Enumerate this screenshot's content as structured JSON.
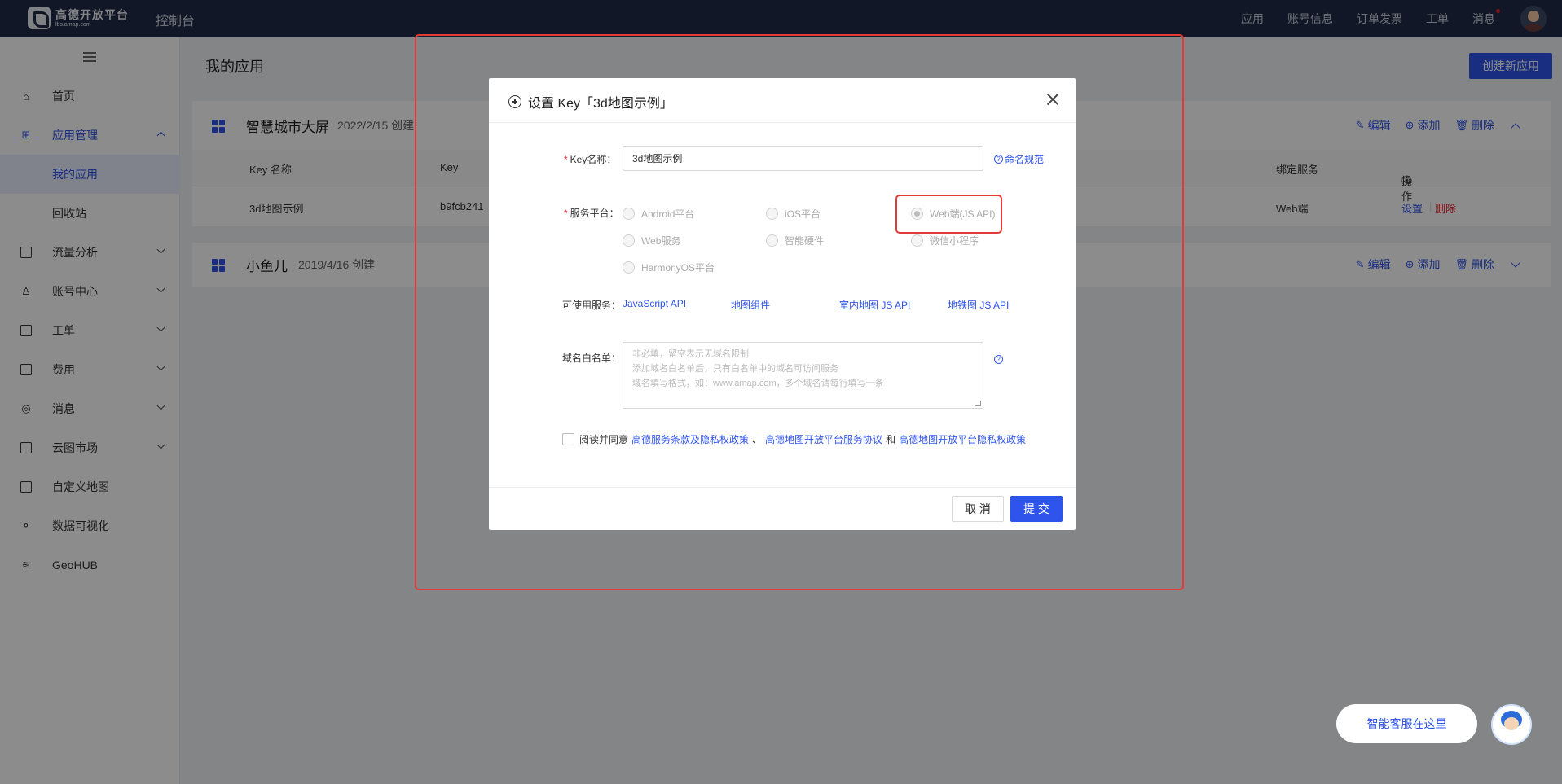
{
  "topbar": {
    "logo_name": "高德开放平台",
    "logo_sub": "lbs.amap.com",
    "title": "控制台",
    "nav": [
      "应用",
      "账号信息",
      "订单发票",
      "工单",
      "消息"
    ]
  },
  "sidebar": {
    "items": [
      {
        "label": "首页",
        "icon": "home-icon"
      },
      {
        "label": "应用管理",
        "icon": "app-grid-icon"
      },
      {
        "label": "我的应用"
      },
      {
        "label": "回收站"
      },
      {
        "label": "流量分析",
        "icon": "chart-icon"
      },
      {
        "label": "账号中心",
        "icon": "user-icon"
      },
      {
        "label": "工单",
        "icon": "ticket-icon"
      },
      {
        "label": "费用",
        "icon": "fee-icon"
      },
      {
        "label": "消息",
        "icon": "message-icon"
      },
      {
        "label": "云图市场",
        "icon": "store-icon"
      },
      {
        "label": "自定义地图",
        "icon": "map-edit-icon"
      },
      {
        "label": "数据可视化",
        "icon": "dataviz-icon"
      },
      {
        "label": "GeoHUB",
        "icon": "layers-icon"
      }
    ]
  },
  "main": {
    "title": "我的应用",
    "create_button": "创建新应用",
    "apps": [
      {
        "name": "智慧城市大屏",
        "date": "2022/2/15 创建",
        "actions": {
          "edit": "编辑",
          "add": "添加",
          "delete": "删除"
        },
        "columns": {
          "key_name": "Key 名称",
          "key": "Key",
          "bound_service": "绑定服务",
          "operation": "操作"
        },
        "rows": [
          {
            "key_name": "3d地图示例",
            "key": "b9fcb241",
            "service": "Web端",
            "op_settings": "设置",
            "op_delete": "删除"
          }
        ]
      },
      {
        "name": "小鱼儿",
        "date": "2019/4/16 创建",
        "actions": {
          "edit": "编辑",
          "add": "添加",
          "delete": "删除"
        }
      }
    ]
  },
  "modal": {
    "title": "设置 Key「3d地图示例」",
    "key_name_label": "Key名称：",
    "key_name_value": "3d地图示例",
    "naming_rule_link": "命名规范",
    "platform_label": "服务平台：",
    "platforms": [
      {
        "label": "Android平台",
        "checked": false
      },
      {
        "label": "iOS平台",
        "checked": false
      },
      {
        "label": "Web端(JS API)",
        "checked": true
      },
      {
        "label": "Web服务",
        "checked": false
      },
      {
        "label": "智能硬件",
        "checked": false
      },
      {
        "label": "微信小程序",
        "checked": false
      },
      {
        "label": "HarmonyOS平台",
        "checked": false
      }
    ],
    "services_label": "可使用服务：",
    "services": [
      "JavaScript API",
      "地图组件",
      "室内地图 JS API",
      "地铁图 JS API"
    ],
    "whitelist_label": "域名白名单：",
    "whitelist_placeholder_lines": [
      "非必填，留空表示无域名限制",
      "添加域名白名单后，只有白名单中的域名可访问服务",
      "域名填写格式，如：www.amap.com，多个域名请每行填写一条"
    ],
    "agree_text": "阅读并同意",
    "agree_link1": "高德服务条款及隐私权政策",
    "agree_sep": "、",
    "agree_link2": "高德地图开放平台服务协议",
    "agree_and": "和",
    "agree_link3": "高德地图开放平台隐私权政策",
    "cancel_button": "取 消",
    "submit_button": "提 交"
  },
  "chat": {
    "bubble_text": "智能客服在这里"
  },
  "colors": {
    "accent": "#2f54eb",
    "topbar_bg": "#1f2b45",
    "danger": "#f5222d",
    "annotation_red": "#e53935"
  }
}
